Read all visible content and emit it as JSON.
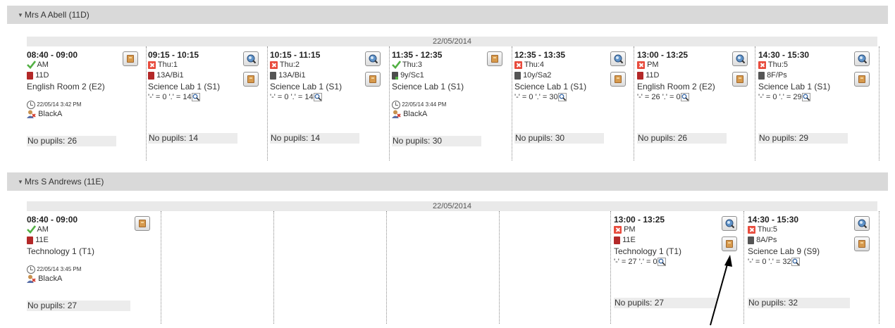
{
  "sections": [
    {
      "header": "Mrs A Abell (11D)",
      "date": "22/05/2014",
      "lessons": [
        {
          "time": "08:40 - 09:00",
          "status_icon": "check-icon",
          "status_text": "AM",
          "book_icon": "book-red-icon",
          "group": "11D",
          "room": "English Room 2 (E2)",
          "counts": "",
          "stamp": "22/05/14 3:42 PM",
          "user": "BlackA",
          "pupils": "No pupils: 26"
        },
        {
          "time": "09:15 - 10:15",
          "status_icon": "x-icon",
          "status_text": "Thu:1",
          "book_icon": "book-red-icon",
          "group": "13A/Bi1",
          "room": "Science Lab 1 (S1)",
          "counts": "'-' = 0 '.' = 14",
          "stamp": "",
          "user": "",
          "pupils": "No pupils: 14"
        },
        {
          "time": "10:15 - 11:15",
          "status_icon": "x-icon",
          "status_text": "Thu:2",
          "book_icon": "book-grey-icon",
          "group": "13A/Bi1",
          "room": "Science Lab 1 (S1)",
          "counts": "'-' = 0 '.' = 14",
          "stamp": "",
          "user": "",
          "pupils": "No pupils: 14"
        },
        {
          "time": "11:35 - 12:35",
          "status_icon": "check-icon",
          "status_text": "Thu:3",
          "book_icon": "book-green-icon",
          "group": "9y/Sc1",
          "room": "Science Lab 1 (S1)",
          "counts": "",
          "stamp": "22/05/14 3:44 PM",
          "user": "BlackA",
          "pupils": "No pupils: 30"
        },
        {
          "time": "12:35 - 13:35",
          "status_icon": "x-icon",
          "status_text": "Thu:4",
          "book_icon": "book-grey-icon",
          "group": "10y/Sa2",
          "room": "Science Lab 1 (S1)",
          "counts": "'-' = 0 '.' = 30",
          "stamp": "",
          "user": "",
          "pupils": "No pupils: 30"
        },
        {
          "time": "13:00 - 13:25",
          "status_icon": "x-icon",
          "status_text": "PM",
          "book_icon": "book-red-icon",
          "group": "11D",
          "room": "English Room 2 (E2)",
          "counts": "'-' = 26 '.' = 0",
          "stamp": "",
          "user": "",
          "pupils": "No pupils: 26"
        },
        {
          "time": "14:30 - 15:30",
          "status_icon": "x-icon",
          "status_text": "Thu:5",
          "book_icon": "book-grey-icon",
          "group": "8F/Ps",
          "room": "Science Lab 1 (S1)",
          "counts": "'-' = 0 '.' = 29",
          "stamp": "",
          "user": "",
          "pupils": "No pupils: 29"
        }
      ]
    },
    {
      "header": "Mrs S Andrews (11E)",
      "date": "22/05/2014",
      "lessons": [
        {
          "time": "08:40 - 09:00",
          "status_icon": "check-icon",
          "status_text": "AM",
          "book_icon": "book-red-icon",
          "group": "11E",
          "room": "Technology 1 (T1)",
          "counts": "",
          "stamp": "22/05/14 3:45 PM",
          "user": "BlackA",
          "pupils": "No pupils: 27"
        },
        {
          "time": "13:00 - 13:25",
          "status_icon": "x-icon",
          "status_text": "PM",
          "book_icon": "book-red-icon",
          "group": "11E",
          "room": "Technology 1 (T1)",
          "counts": "'-' = 27 '.' = 0",
          "stamp": "",
          "user": "",
          "pupils": "No pupils: 27"
        },
        {
          "time": "14:30 - 15:30",
          "status_icon": "x-icon",
          "status_text": "Thu:5",
          "book_icon": "book-grey-icon",
          "group": "8A/Ps",
          "room": "Science Lab 9 (S9)",
          "counts": "'-' = 0 '.' = 32",
          "stamp": "",
          "user": "",
          "pupils": "No pupils: 32"
        }
      ]
    }
  ],
  "colors": {
    "header_bg": "#d9d9d9",
    "absent_red": "#e84c3d",
    "present_green": "#52b043",
    "register_orange": "#d79a4d"
  }
}
